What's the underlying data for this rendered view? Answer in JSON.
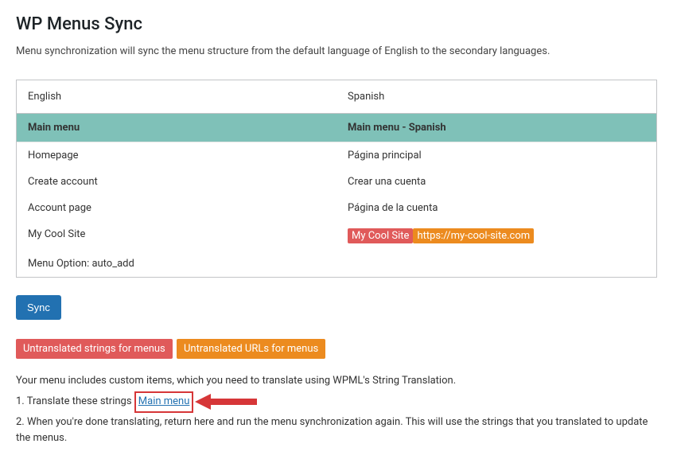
{
  "header": {
    "title": "WP Menus Sync",
    "intro": "Menu synchronization will sync the menu structure from the default language of English to the secondary languages."
  },
  "table": {
    "headers": {
      "english": "English",
      "spanish": "Spanish"
    },
    "menu_row": {
      "english": "Main menu",
      "spanish": "Main menu - Spanish"
    },
    "rows": [
      {
        "english": "Homepage",
        "spanish": "Página principal"
      },
      {
        "english": "Create account",
        "spanish": "Crear una cuenta"
      },
      {
        "english": "Account page",
        "spanish": "Página de la cuenta"
      }
    ],
    "custom_row": {
      "english": "My Cool Site",
      "spanish_label": "My Cool Site",
      "spanish_url": "https://my-cool-site.com"
    },
    "option_row": {
      "english": "Menu Option: auto_add"
    }
  },
  "buttons": {
    "sync": "Sync"
  },
  "legend": {
    "strings": "Untranslated strings for menus",
    "urls": "Untranslated URLs for menus"
  },
  "instructions": {
    "intro": "Your menu includes custom items, which you need to translate using WPML's String Translation.",
    "step1_prefix": "1. Translate these strings ",
    "step1_link": "Main menu",
    "step2": "2. When you're done translating, return here and run the menu synchronization again. This will use the strings that you translated to update the menus."
  }
}
